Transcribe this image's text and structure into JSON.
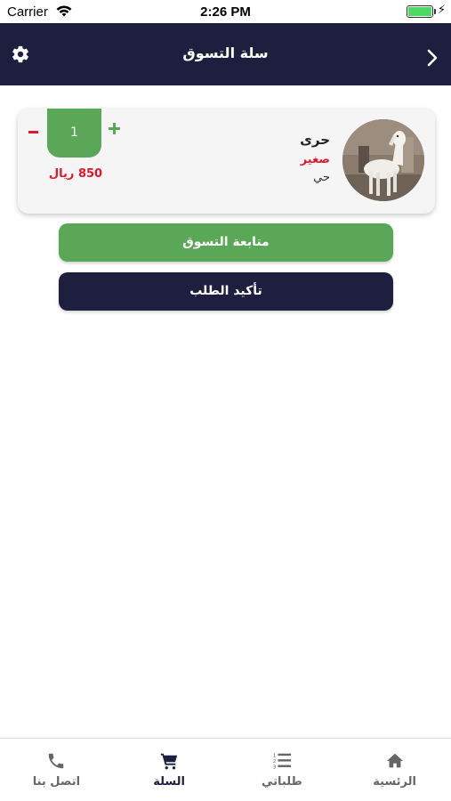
{
  "status_bar": {
    "carrier": "Carrier",
    "time": "2:26 PM",
    "battery_percent": 100
  },
  "header": {
    "title": "سلة التسوق",
    "left_icon": "gear-icon",
    "right_icon": "chevron-right-icon"
  },
  "cart_item": {
    "name": "حرى",
    "size": "صغير",
    "type": "حي",
    "quantity": "1",
    "price": "850 ريال",
    "image": "white-goat-photo"
  },
  "actions": {
    "continue_label": "متابعة التسوق",
    "confirm_label": "تأكيد الطلب"
  },
  "tabs": [
    {
      "label": "اتصل بنا",
      "icon": "phone-icon",
      "active": false
    },
    {
      "label": "السلة",
      "icon": "cart-icon",
      "active": true
    },
    {
      "label": "طلباتي",
      "icon": "list-icon",
      "active": false
    },
    {
      "label": "الرئسية",
      "icon": "home-icon",
      "active": false
    }
  ],
  "colors": {
    "primary": "#1e1f3f",
    "accent_green": "#5aa857",
    "alert_red": "#e3172c"
  }
}
